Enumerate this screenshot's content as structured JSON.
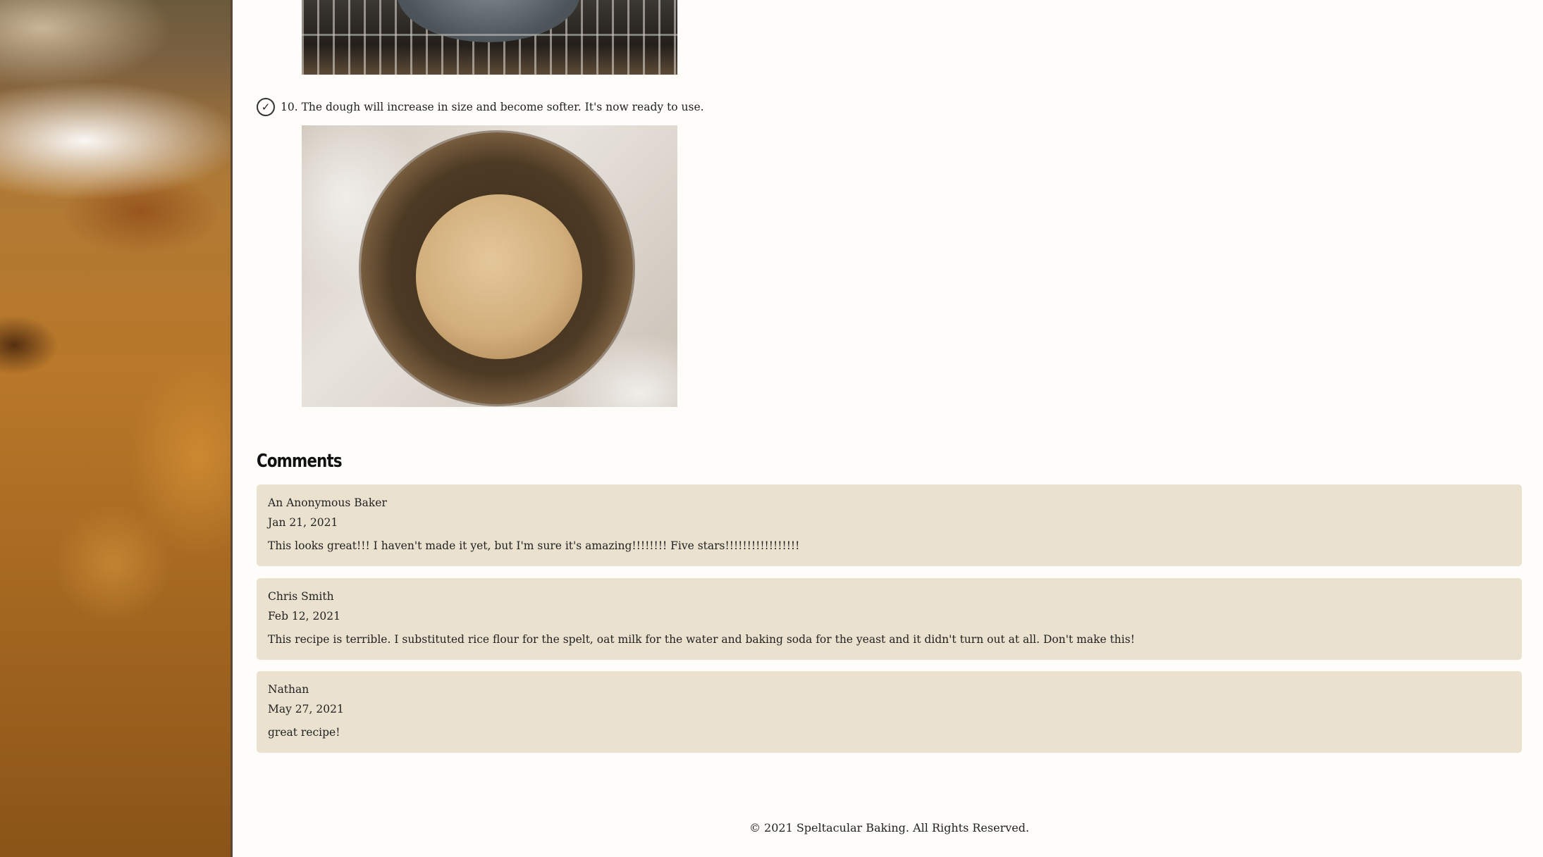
{
  "step": {
    "label": "10. The dough will increase in size and become softer. It's now ready to use."
  },
  "comments": {
    "title": "Comments",
    "items": [
      {
        "author": "An Anonymous Baker",
        "date": "Jan 21, 2021",
        "text": "This looks great!!! I haven't made it yet, but I'm sure it's amazing!!!!!!!! Five stars!!!!!!!!!!!!!!!!!"
      },
      {
        "author": "Chris Smith",
        "date": "Feb 12, 2021",
        "text": "This recipe is terrible. I substituted rice flour for the spelt, oat milk for the water and baking soda for the yeast and it didn't turn out at all. Don't make this!"
      },
      {
        "author": "Nathan",
        "date": "May 27, 2021",
        "text": "great recipe!"
      }
    ]
  },
  "footer": {
    "copyright": "© 2021 Speltacular Baking. All Rights Reserved."
  },
  "icons": {
    "step_check": "check-circle-icon"
  }
}
